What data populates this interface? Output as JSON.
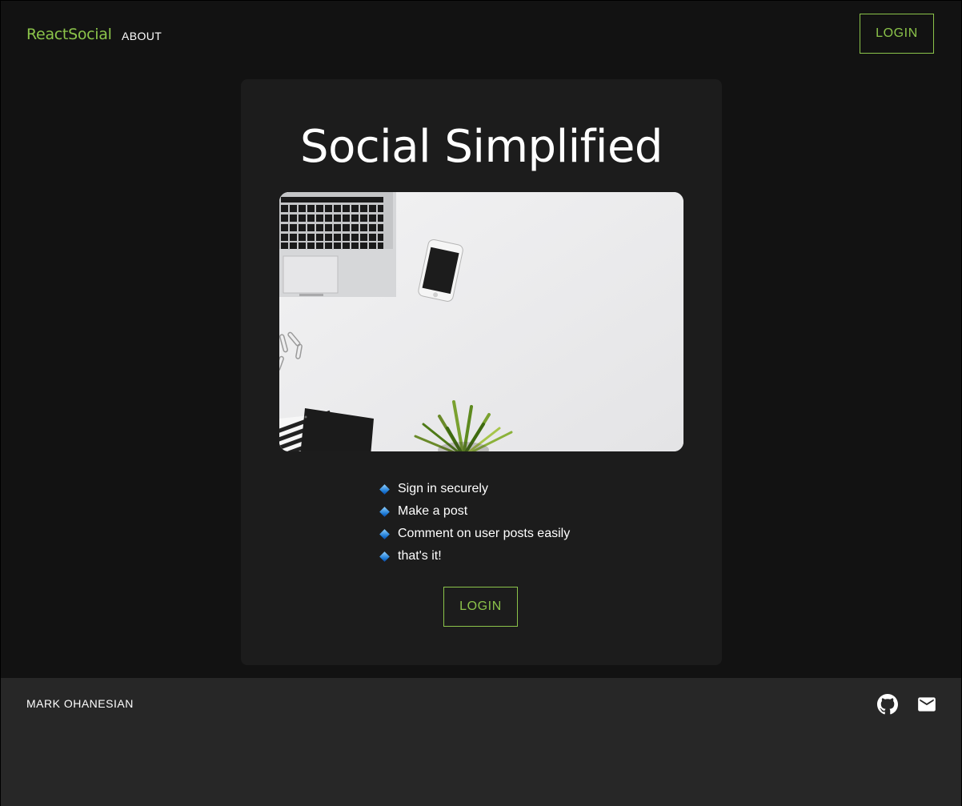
{
  "navbar": {
    "brand": "ReactSocial",
    "about": "ABOUT",
    "login": "LOGIN"
  },
  "hero": {
    "title": "Social Simplified",
    "image_description_icon": "workspace-photo",
    "features": [
      "Sign in securely",
      "Make a post",
      "Comment on user posts easily",
      "that's it!"
    ],
    "login": "LOGIN"
  },
  "footer": {
    "name": "MARK OHANESIAN",
    "icons": [
      "github-icon",
      "mail-icon"
    ]
  },
  "colors": {
    "accent": "#8bc34a",
    "background": "#121212",
    "card": "#1c1c1c",
    "footer": "#272727"
  }
}
